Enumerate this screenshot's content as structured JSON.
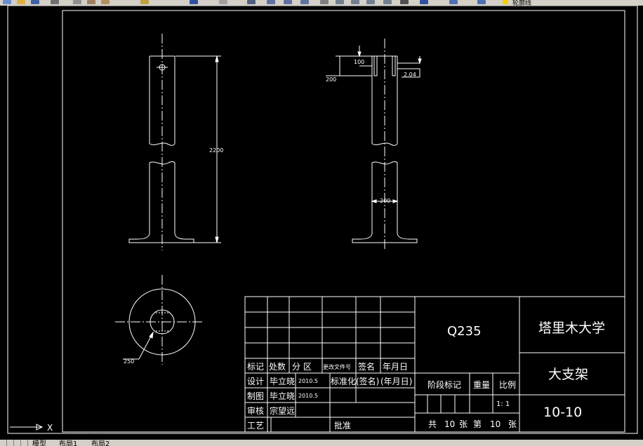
{
  "toolbar": {
    "layer_name": "轮廓线"
  },
  "drawing": {
    "front_view": {
      "height_dim": "2200"
    },
    "side_view": {
      "dim_100": "100",
      "dim_200": "200",
      "dim_204": "2.04",
      "dim_bottom": "200"
    },
    "top_view": {
      "dim_250": "250"
    }
  },
  "title_block": {
    "material": "Q235",
    "school": "塔里木大学",
    "part_name": "大支架",
    "drawing_no": "10-10",
    "row_labels": {
      "mark": "标记",
      "count": "处数",
      "zone": "分 区",
      "change_doc": "更改文件号",
      "signature": "签名",
      "date": "年月日",
      "design": "设计",
      "draw": "制图",
      "review": "审核",
      "process": "工艺",
      "standardize": "标准化",
      "standardize_sign": "(签名)",
      "standardize_date": "(年月日)",
      "approve": "批准"
    },
    "people": {
      "designer": "毕立晓",
      "design_date": "2010.5",
      "drafter": "毕立晓",
      "draw_date": "2010.5",
      "reviewer": "宗望远"
    },
    "stage_label": "阶段标记",
    "weight_label": "重量",
    "scale_label": "比例",
    "scale_value": "1: 1",
    "sheets_total_prefix": "共",
    "sheets_total": "10",
    "sheets_unit": "张",
    "sheet_prefix": "第",
    "sheet_no": "10",
    "sheet_unit": "张"
  },
  "ucs": {
    "x_label": "X"
  },
  "layout_tabs": {
    "model": "模型",
    "layout1": "布局1",
    "layout2": "布局2"
  }
}
